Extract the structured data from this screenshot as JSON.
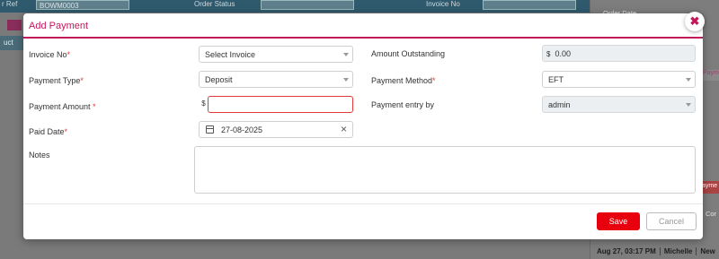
{
  "background": {
    "order_ref_label": "r Ref",
    "order_ref_value": "BOWM0003",
    "order_status_label": "Order Status",
    "invoice_no_label": "Invoice No",
    "tab_label": "uct",
    "right_top_text": "Order Date",
    "right_tab_text": "Paym",
    "right_side_tag": "ayme",
    "right_cor_text": "Cor",
    "bottom_time": "Aug 27, 03:17 PM",
    "bottom_user": "Michelle",
    "bottom_new": "New"
  },
  "modal": {
    "title": "Add Payment",
    "close_icon": "close-icon"
  },
  "form": {
    "invoice_no": {
      "label": "Invoice No",
      "required": "*",
      "value": "Select Invoice"
    },
    "payment_type": {
      "label": "Payment Type",
      "required": "*",
      "value": "Deposit"
    },
    "payment_amount": {
      "label": "Payment Amount",
      "required": "*",
      "prefix": "$",
      "value": ""
    },
    "paid_date": {
      "label": "Paid Date",
      "required": "*",
      "value": "27-08-2025"
    },
    "notes": {
      "label": "Notes",
      "value": ""
    },
    "amount_outstanding": {
      "label": "Amount Outstanding",
      "prefix": "$",
      "value": "0.00"
    },
    "payment_method": {
      "label": "Payment Method",
      "required": "*",
      "value": "EFT"
    },
    "payment_entry_by": {
      "label": "Payment entry by",
      "value": "admin"
    }
  },
  "footer": {
    "save_label": "Save",
    "cancel_label": "Cancel"
  },
  "colors": {
    "accent": "#c2185b",
    "required": "#e53935",
    "save": "#e8000f"
  }
}
